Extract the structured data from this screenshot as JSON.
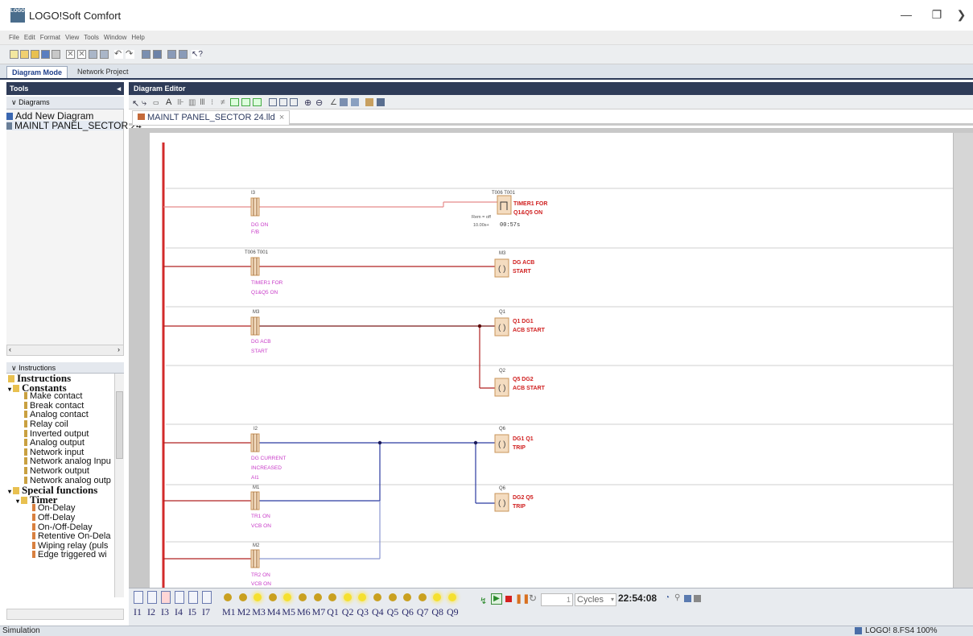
{
  "window": {
    "title": "LOGO!Soft Comfort",
    "logo_text": "LOGO",
    "minimize": "—",
    "maximize": "❐",
    "close": "❯"
  },
  "menu": [
    "File",
    "Edit",
    "Format",
    "View",
    "Tools",
    "Window",
    "Help"
  ],
  "mode_tabs": {
    "diagram_mode": "Diagram Mode",
    "network_project": "Network Project"
  },
  "left_panel": {
    "tools_header": "Tools",
    "diagrams_header": "Diagrams",
    "diagrams": [
      "Add New Diagram",
      "MAINLT PANEL_SECTOR 24"
    ],
    "instructions_header": "Instructions",
    "tree": [
      {
        "label": "Instructions",
        "level": 0,
        "bold": true,
        "toggle": ""
      },
      {
        "label": "Constants",
        "level": 0,
        "bold": true,
        "toggle": "▾"
      },
      {
        "label": "Make contact",
        "level": 2,
        "bold": false,
        "toggle": ""
      },
      {
        "label": "Break contact",
        "level": 2,
        "bold": false,
        "toggle": ""
      },
      {
        "label": "Analog contact",
        "level": 2,
        "bold": false,
        "toggle": ""
      },
      {
        "label": "Relay coil",
        "level": 2,
        "bold": false,
        "toggle": ""
      },
      {
        "label": "Inverted output",
        "level": 2,
        "bold": false,
        "toggle": ""
      },
      {
        "label": "Analog output",
        "level": 2,
        "bold": false,
        "toggle": ""
      },
      {
        "label": "Network input",
        "level": 2,
        "bold": false,
        "toggle": ""
      },
      {
        "label": "Network analog Inpu",
        "level": 2,
        "bold": false,
        "toggle": ""
      },
      {
        "label": "Network output",
        "level": 2,
        "bold": false,
        "toggle": ""
      },
      {
        "label": "Network analog outp",
        "level": 2,
        "bold": false,
        "toggle": ""
      },
      {
        "label": "Special functions",
        "level": 0,
        "bold": true,
        "toggle": "▾"
      },
      {
        "label": "Timer",
        "level": 1,
        "bold": true,
        "toggle": "▾"
      },
      {
        "label": "On-Delay",
        "level": 3,
        "bold": false,
        "toggle": ""
      },
      {
        "label": "Off-Delay",
        "level": 3,
        "bold": false,
        "toggle": ""
      },
      {
        "label": "On-/Off-Delay",
        "level": 3,
        "bold": false,
        "toggle": ""
      },
      {
        "label": "Retentive On-Dela",
        "level": 3,
        "bold": false,
        "toggle": ""
      },
      {
        "label": "Wiping relay (puls",
        "level": 3,
        "bold": false,
        "toggle": ""
      },
      {
        "label": "Edge triggered wi",
        "level": 3,
        "bold": false,
        "toggle": ""
      }
    ]
  },
  "editor": {
    "header": "Diagram Editor",
    "file_tab": "MAINLT PANEL_SECTOR 24.lld",
    "file_tab_close": "×"
  },
  "diagram": {
    "rungs": [
      {
        "contact_addr": "I3",
        "contact_label": [
          "DG ON",
          "F/B"
        ],
        "coil_addr": "T006 T001",
        "coil_label": [
          "TIMER1 FOR",
          "Q1&Q5 ON"
        ],
        "timer_rem": "Rem = off",
        "timer_preset": "10.00s+",
        "timer_value": "00:57s"
      },
      {
        "contact_addr": "T006 T001",
        "contact_label": [
          "TIMER1 FOR",
          "Q1&Q5 ON"
        ],
        "coil_addr": "M3",
        "coil_label": [
          "DG ACB",
          "START"
        ]
      },
      {
        "contact_addr": "M3",
        "contact_label": [
          "DG ACB",
          "START"
        ],
        "coil_addr": "Q1",
        "coil_label": [
          "Q1 DG1",
          "ACB START"
        ]
      },
      {
        "coil_addr": "Q2",
        "coil_label": [
          "Q5 DG2",
          "ACB START"
        ]
      },
      {
        "contact_addr": "I2",
        "contact_label": [
          "DG CURRENT",
          "INCREASED",
          "AI1"
        ],
        "coil_addr": "Q6",
        "coil_label": [
          "DG1 Q1",
          "TRIP"
        ]
      },
      {
        "contact_addr": "M1",
        "contact_label": [
          "TR1 ON",
          "VCB ON"
        ],
        "coil_addr": "Q6",
        "coil_label": [
          "DG2 Q5",
          "TRIP"
        ]
      },
      {
        "contact_addr": "M2",
        "contact_label": [
          "TR2 ON",
          "VCB ON"
        ]
      }
    ]
  },
  "sim": {
    "inputs": [
      "I1",
      "I2",
      "I3",
      "I4",
      "I5",
      "I7"
    ],
    "outputs": [
      "M1",
      "M2",
      "M3",
      "M4",
      "M5",
      "M6",
      "M7",
      "Q1",
      "Q2",
      "Q3",
      "Q4",
      "Q5",
      "Q6",
      "Q7",
      "Q8",
      "Q9"
    ],
    "cycles_value": "1",
    "cycles_label": "Cycles",
    "time": "22:54:08"
  },
  "status": {
    "left": "Simulation",
    "right": "LOGO! 8.FS4 100%"
  },
  "colors": {
    "power_rail": "#d22a2a",
    "wire_red": "#b02020",
    "wire_blue": "#2a3aa0",
    "label_magenta": "#c83ac8",
    "coil_label": "#d02020",
    "panel_header": "#2f3c58"
  }
}
